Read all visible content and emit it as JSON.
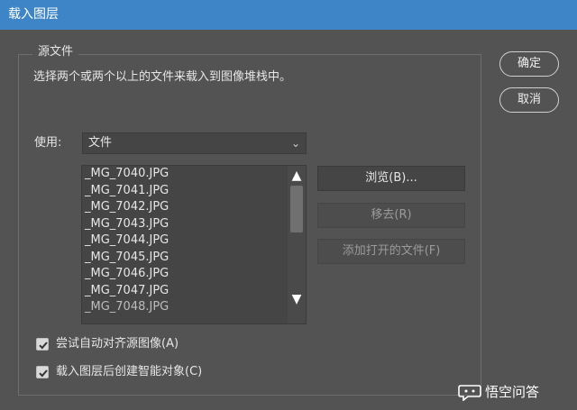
{
  "window": {
    "title": "载入图层"
  },
  "source_group": {
    "legend": "源文件",
    "description": "选择两个或两个以上的文件来载入到图像堆栈中。"
  },
  "use": {
    "label": "使用:",
    "selected": "文件"
  },
  "files": [
    "_MG_7040.JPG",
    "_MG_7041.JPG",
    "_MG_7042.JPG",
    "_MG_7043.JPG",
    "_MG_7044.JPG",
    "_MG_7045.JPG",
    "_MG_7046.JPG",
    "_MG_7047.JPG",
    "_MG_7048.JPG"
  ],
  "buttons": {
    "browse": "浏览(B)...",
    "remove": "移去(R)",
    "add_open": "添加打开的文件(F)",
    "ok": "确定",
    "cancel": "取消"
  },
  "options": {
    "auto_align": {
      "label": "尝试自动对齐源图像(A)",
      "checked": true
    },
    "smart_object": {
      "label": "载入图层后创建智能对象(C)",
      "checked": true
    }
  },
  "watermark": {
    "text": "悟空问答"
  }
}
